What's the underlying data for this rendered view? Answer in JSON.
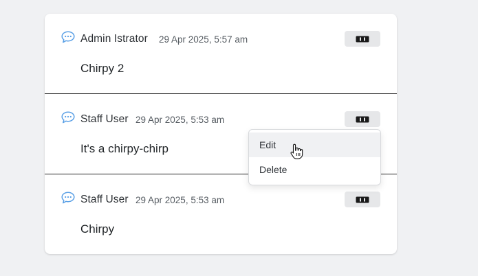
{
  "comments": [
    {
      "author": "Admin Istrator",
      "time": "29 Apr 2025, 5:57 am",
      "text": "Chirpy 2"
    },
    {
      "author": "Staff User",
      "time": "29 Apr 2025, 5:53 am",
      "text": "It's a chirpy-chirp"
    },
    {
      "author": "Staff User",
      "time": "29 Apr 2025, 5:53 am",
      "text": "Chirpy"
    }
  ],
  "dropdown": {
    "items": [
      {
        "label": "Edit"
      },
      {
        "label": "Delete"
      }
    ]
  },
  "icons": {
    "comment": "speech-bubble-icon",
    "menu": "card-menu-icon",
    "cursor": "hand-pointer-icon"
  },
  "colors": {
    "icon_blue": "#5aa0e6",
    "divider": "#1f1f1f",
    "button_bg": "#e6e7e9"
  }
}
